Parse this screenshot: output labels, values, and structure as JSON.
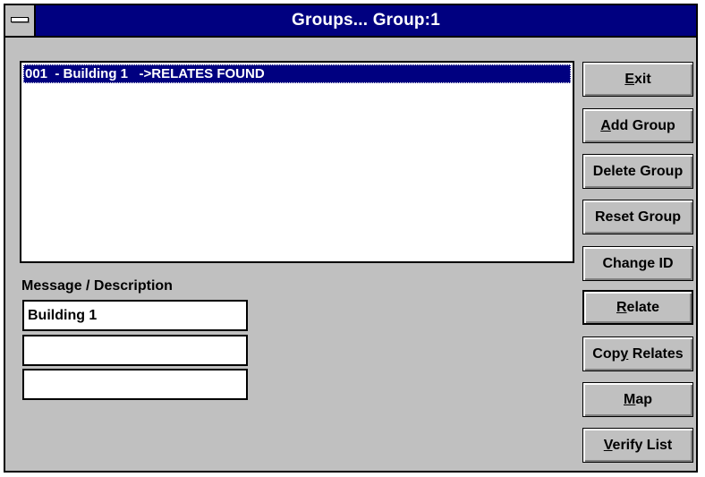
{
  "window": {
    "title": "Groups... Group:1"
  },
  "list": {
    "items": [
      {
        "label": "001  - Building 1   ->RELATES FOUND",
        "selected": true
      }
    ]
  },
  "message": {
    "label": "Message / Description",
    "lines": [
      "Building 1",
      "",
      ""
    ]
  },
  "buttons": [
    {
      "name": "exit-button",
      "pre": "",
      "accel": "E",
      "post": "xit"
    },
    {
      "name": "add-group-button",
      "pre": "",
      "accel": "A",
      "post": "dd Group"
    },
    {
      "name": "delete-group-button",
      "pre": "Delete Group",
      "accel": "",
      "post": ""
    },
    {
      "name": "reset-group-button",
      "pre": "Reset Group",
      "accel": "",
      "post": ""
    },
    {
      "name": "change-id-button",
      "pre": "Change ID",
      "accel": "",
      "post": ""
    },
    {
      "name": "relate-button",
      "pre": "",
      "accel": "R",
      "post": "elate",
      "default": true
    },
    {
      "name": "copy-relates-button",
      "pre": "Cop",
      "accel": "y",
      "post": " Relates"
    },
    {
      "name": "map-button",
      "pre": "",
      "accel": "M",
      "post": "ap"
    },
    {
      "name": "verify-list-button",
      "pre": "",
      "accel": "V",
      "post": "erify List"
    }
  ]
}
